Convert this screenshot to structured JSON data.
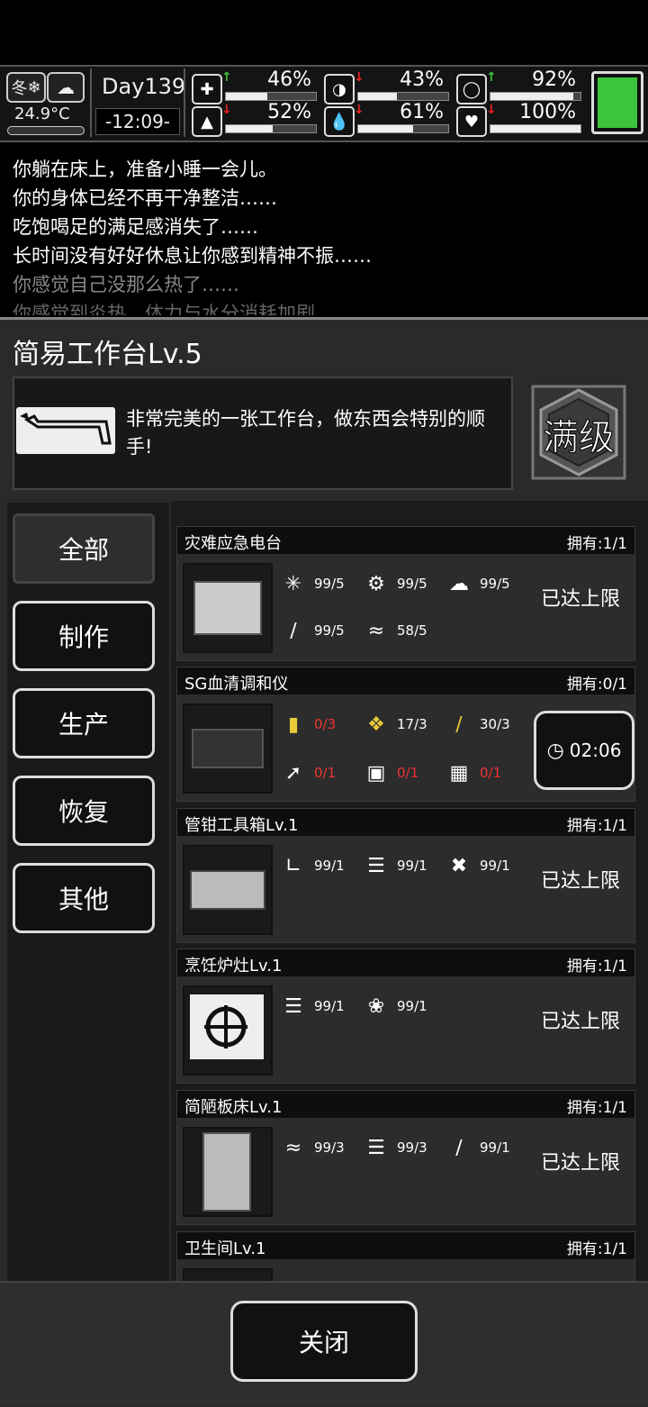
{
  "status": {
    "season": "冬",
    "temperature": "24.9°C",
    "day": "Day139",
    "time": "-12:09-",
    "stats": [
      {
        "icon": "medkit-icon",
        "trend": "up",
        "value": "46%",
        "level": 0.46
      },
      {
        "icon": "stomach-icon",
        "trend": "down",
        "value": "43%",
        "level": 0.43
      },
      {
        "icon": "toilet-icon",
        "trend": "up",
        "value": "92%",
        "level": 0.92
      },
      {
        "icon": "boot-icon",
        "trend": "down",
        "value": "52%",
        "level": 0.52
      },
      {
        "icon": "water-drop-icon",
        "trend": "down",
        "value": "61%",
        "level": 0.61
      },
      {
        "icon": "heart-icon",
        "trend": "down",
        "value": "100%",
        "level": 1.0
      }
    ],
    "battery_color": "#3cc43c"
  },
  "log": [
    "你躺在床上，准备小睡一会儿。",
    "你的身体已经不再干净整洁……",
    "吃饱喝足的满足感消失了……",
    "长时间没有好好休息让你感到精神不振……",
    "你感觉自己没那么热了……",
    "你感觉到炎热，体力与水分消耗加剧……"
  ],
  "workbench": {
    "title": "简易工作台Lv.5",
    "description": "非常完美的一张工作台，做东西会特别的顺手!",
    "max_label": "满级"
  },
  "tabs": [
    "全部",
    "制作",
    "生产",
    "恢复",
    "其他"
  ],
  "items": [
    {
      "name": "灾难应急电台",
      "owned": "拥有:1/1",
      "status": "已达上限",
      "materials": [
        {
          "icon": "wires-icon",
          "qty": "99/5",
          "short": false
        },
        {
          "icon": "gears-icon",
          "qty": "99/5",
          "short": false
        },
        {
          "icon": "cotton-icon",
          "qty": "99/5",
          "short": false
        },
        {
          "icon": "twigs-icon",
          "qty": "99/5",
          "short": false
        },
        {
          "icon": "cloth-icon",
          "qty": "58/5",
          "short": false
        }
      ]
    },
    {
      "name": "SG血清调和仪",
      "owned": "拥有:0/1",
      "timer": "02:06",
      "materials": [
        {
          "icon": "gold-card-icon",
          "qty": "0/3",
          "short": true
        },
        {
          "icon": "gold-parts-icon",
          "qty": "17/3",
          "short": false
        },
        {
          "icon": "gold-rods-icon",
          "qty": "30/3",
          "short": false
        },
        {
          "icon": "syringe-icon",
          "qty": "0/1",
          "short": true
        },
        {
          "icon": "chip-icon",
          "qty": "0/1",
          "short": true
        },
        {
          "icon": "circuit-board-icon",
          "qty": "0/1",
          "short": true
        }
      ]
    },
    {
      "name": "管钳工具箱Lv.1",
      "owned": "拥有:1/1",
      "status": "已达上限",
      "materials": [
        {
          "icon": "pipe-icon",
          "qty": "99/1",
          "short": false
        },
        {
          "icon": "logs-icon",
          "qty": "99/1",
          "short": false
        },
        {
          "icon": "tape-icon",
          "qty": "99/1",
          "short": false
        }
      ]
    },
    {
      "name": "烹饪炉灶Lv.1",
      "owned": "拥有:1/1",
      "status": "已达上限",
      "materials": [
        {
          "icon": "logs-icon",
          "qty": "99/1",
          "short": false
        },
        {
          "icon": "fur-icon",
          "qty": "99/1",
          "short": false
        }
      ]
    },
    {
      "name": "简陋板床Lv.1",
      "owned": "拥有:1/1",
      "status": "已达上限",
      "materials": [
        {
          "icon": "cloth-icon",
          "qty": "99/3",
          "short": false
        },
        {
          "icon": "logs-icon",
          "qty": "99/3",
          "short": false
        },
        {
          "icon": "nails-icon",
          "qty": "99/1",
          "short": false
        }
      ]
    },
    {
      "name": "卫生间Lv.1",
      "owned": "拥有:1/1"
    }
  ],
  "close_label": "关闭"
}
